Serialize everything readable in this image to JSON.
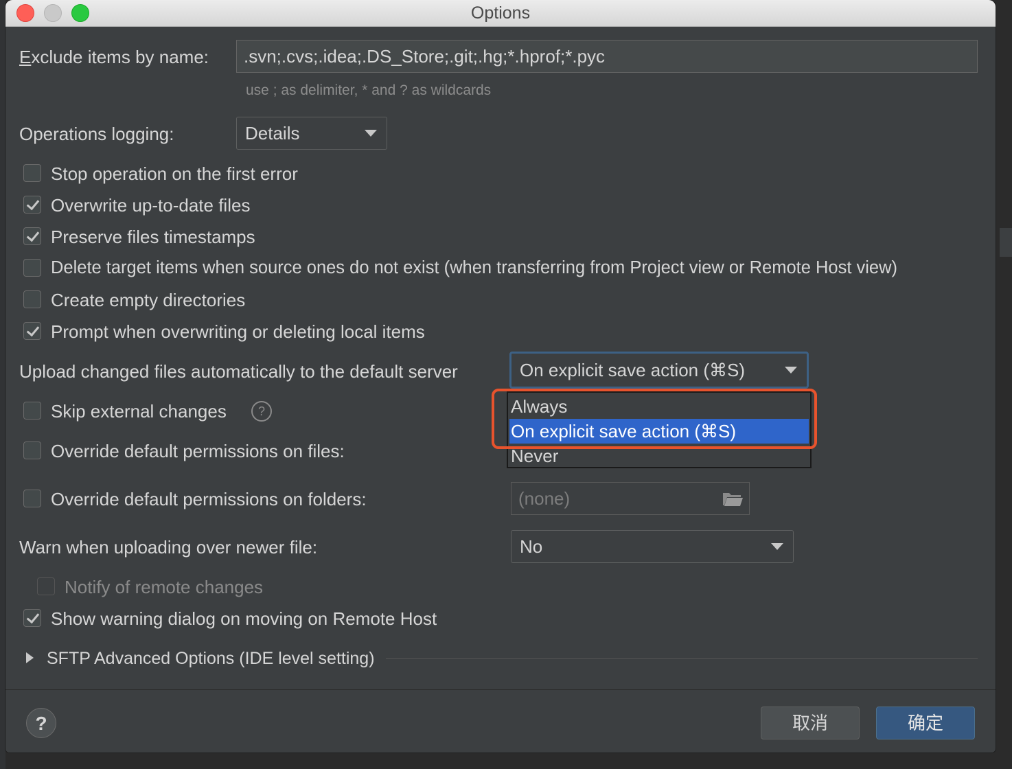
{
  "window": {
    "title": "Options"
  },
  "exclude": {
    "label_prefix": "E",
    "label_rest": "xclude items by name:",
    "value": ".svn;.cvs;.idea;.DS_Store;.git;.hg;*.hprof;*.pyc",
    "hint": "use ; as delimiter, * and ? as wildcards"
  },
  "logging": {
    "label": "Operations logging:",
    "value": "Details"
  },
  "checkboxes": [
    {
      "label": "Stop operation on the first error",
      "checked": false
    },
    {
      "label": "Overwrite up-to-date files",
      "checked": true
    },
    {
      "label": "Preserve files timestamps",
      "checked": true
    },
    {
      "label": "Delete target items when source ones do not exist (when transferring from Project view or Remote Host view)",
      "checked": false
    },
    {
      "label": "Create empty directories",
      "checked": false
    },
    {
      "label": "Prompt when overwriting or deleting local items",
      "checked": true
    }
  ],
  "upload": {
    "label": "Upload changed files automatically to the default server",
    "value": "On explicit save action (⌘S)",
    "options": [
      "Always",
      "On explicit save action (⌘S)",
      "Never"
    ],
    "selected_index": 1
  },
  "skip_external": {
    "label": "Skip external changes",
    "checked": false,
    "help": "?"
  },
  "override_files": {
    "label": "Override default permissions on files:",
    "checked": false
  },
  "override_folders": {
    "label": "Override default permissions on folders:",
    "checked": false,
    "value": "(none)"
  },
  "warn_newer": {
    "label": "Warn when uploading over newer file:",
    "value": "No"
  },
  "notify_remote": {
    "label": "Notify of remote changes",
    "checked": false,
    "enabled": false
  },
  "show_warning": {
    "label": "Show warning dialog on moving on Remote Host",
    "checked": true
  },
  "sftp_advanced": {
    "label": "SFTP Advanced Options (IDE level setting)"
  },
  "footer": {
    "help": "?",
    "cancel": "取消",
    "ok": "确定"
  }
}
